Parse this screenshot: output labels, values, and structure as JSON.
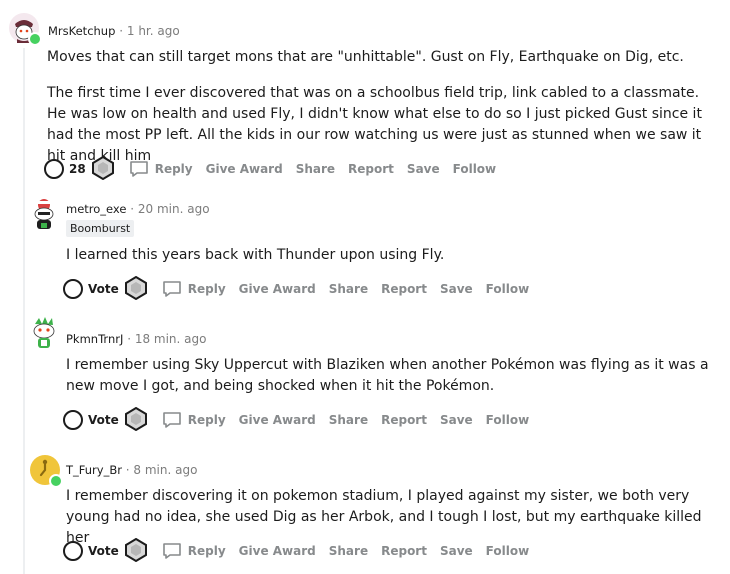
{
  "comments": [
    {
      "username": "MrsKetchup",
      "time": "· 1 hr. ago",
      "flair": "",
      "paragraphs": [
        "Moves that can still target mons that are \"unhittable\". Gust on Fly, Earthquake on Dig, etc.",
        "The first time I ever discovered that was on a schoolbus field trip, link cabled to a classmate. He was low on health and used Fly, I didn't know what else to do so I just picked Gust since it had the most PP left. All the kids in our row watching us were just as stunned when we saw it hit and kill him"
      ],
      "vote_label": "28"
    },
    {
      "username": "metro_exe",
      "time": "· 20 min. ago",
      "flair": "Boomburst",
      "paragraphs": [
        "I learned this years back with Thunder upon using Fly."
      ],
      "vote_label": "Vote"
    },
    {
      "username": "PkmnTrnrJ",
      "time": "· 18 min. ago",
      "flair": "",
      "paragraphs": [
        "I remember using Sky Uppercut with Blaziken when another Pokémon was flying as it was a new move I got, and being shocked when it hit the Pokémon."
      ],
      "vote_label": "Vote"
    },
    {
      "username": "T_Fury_Br",
      "time": "· 8 min. ago",
      "flair": "",
      "paragraphs": [
        "I remember discovering it on pokemon stadium, I played against my sister, we both very young had no idea, she used Dig as her Arbok, and I tough I lost, but my earthquake killed her"
      ],
      "vote_label": "Vote"
    }
  ],
  "actions": {
    "reply": "Reply",
    "give_award": "Give Award",
    "share": "Share",
    "report": "Report",
    "save": "Save",
    "follow": "Follow"
  },
  "colors": {
    "online": "#46d160",
    "meta": "#7c7c7c",
    "action": "#878a8c",
    "thread_line": "#edeff1"
  },
  "icons": {
    "vote": "vote-circle-icon",
    "award": "award-gem-icon",
    "reply": "reply-bubble-icon"
  }
}
